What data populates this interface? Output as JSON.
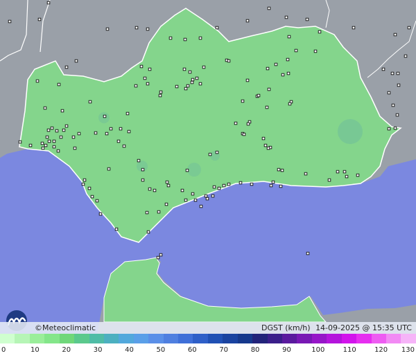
{
  "brand": {
    "text": "©Meteoclimatic",
    "logo_icon": "meteoclimatic-logo-icon"
  },
  "info": {
    "variable": "DGST",
    "unit": "(km/h)",
    "datetime": "14-09-2025 @ 15:35 UTC"
  },
  "scale": {
    "labels": [
      "0",
      "10",
      "20",
      "30",
      "40",
      "50",
      "60",
      "70",
      "80",
      "90",
      "100",
      "110",
      "120",
      "130"
    ],
    "colors": [
      "#cfffcf",
      "#b6f5b6",
      "#9aee9a",
      "#84e68a",
      "#6fd77a",
      "#5bc98d",
      "#4fbca6",
      "#4cb0c0",
      "#52a8dc",
      "#5a9fe8",
      "#5a8fe8",
      "#4f7fe0",
      "#3f6fd8",
      "#2f5fc8",
      "#2050b4",
      "#1a43a0",
      "#16388c",
      "#22237a",
      "#3a1e8a",
      "#5a1a9e",
      "#7818b4",
      "#9616c8",
      "#b414dc",
      "#d214ec",
      "#e62ef0",
      "#ee5cf2",
      "#f28af4",
      "#f6b4f8"
    ]
  },
  "map": {
    "sea_color": "#7b88e0",
    "land_color": "#9aa0a8",
    "region_color": "#84d58c",
    "station_icon": "station-marker-icon"
  }
}
